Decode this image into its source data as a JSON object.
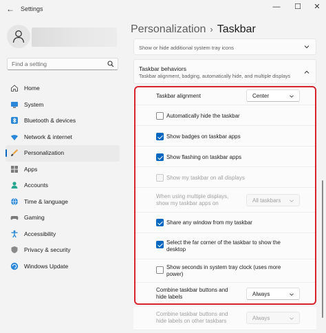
{
  "window": {
    "title": "Settings",
    "back_glyph": "←",
    "minimize_glyph": "—",
    "maximize_glyph": "☐",
    "close_glyph": "✕"
  },
  "search": {
    "placeholder": "Find a setting"
  },
  "nav": [
    {
      "label": "Home",
      "icon": "home-icon"
    },
    {
      "label": "System",
      "icon": "system-icon"
    },
    {
      "label": "Bluetooth & devices",
      "icon": "bluetooth-icon"
    },
    {
      "label": "Network & internet",
      "icon": "network-icon"
    },
    {
      "label": "Personalization",
      "icon": "brush-icon",
      "active": true
    },
    {
      "label": "Apps",
      "icon": "apps-icon"
    },
    {
      "label": "Accounts",
      "icon": "accounts-icon"
    },
    {
      "label": "Time & language",
      "icon": "globe-icon"
    },
    {
      "label": "Gaming",
      "icon": "gaming-icon"
    },
    {
      "label": "Accessibility",
      "icon": "accessibility-icon"
    },
    {
      "label": "Privacy & security",
      "icon": "shield-icon"
    },
    {
      "label": "Windows Update",
      "icon": "update-icon"
    }
  ],
  "breadcrumb": {
    "parent": "Personalization",
    "separator": "›",
    "current": "Taskbar"
  },
  "tray_card": {
    "text": "Show or hide additional system tray icons"
  },
  "behaviors": {
    "title": "Taskbar behaviors",
    "subtitle": "Taskbar alignment, badging, automatically hide, and multiple displays",
    "alignment": {
      "label": "Taskbar alignment",
      "value": "Center"
    },
    "auto_hide": {
      "label": "Automatically hide the taskbar",
      "checked": false
    },
    "badges": {
      "label": "Show badges on taskbar apps",
      "checked": true
    },
    "flashing": {
      "label": "Show flashing on taskbar apps",
      "checked": true
    },
    "all_displays": {
      "label": "Show my taskbar on all displays",
      "checked": false,
      "disabled": true
    },
    "multi_display": {
      "line1": "When using multiple displays,",
      "line2": "show my taskbar apps on",
      "value": "All taskbars"
    },
    "share_window": {
      "label": "Share any window from my taskbar",
      "checked": true
    },
    "far_corner": {
      "line1": "Select the far corner of the taskbar to show the",
      "line2": "desktop",
      "checked": true
    },
    "seconds": {
      "line1": "Show seconds in system tray clock (uses more",
      "line2": "power)",
      "checked": false
    },
    "combine": {
      "line1": "Combine taskbar buttons and",
      "line2": "hide labels",
      "value": "Always"
    },
    "combine_other": {
      "line1": "Combine taskbar buttons and",
      "line2": "hide labels on other taskbars",
      "value": "Always"
    }
  },
  "colors": {
    "accent": "#0067c0",
    "highlight": "#d9232b"
  }
}
